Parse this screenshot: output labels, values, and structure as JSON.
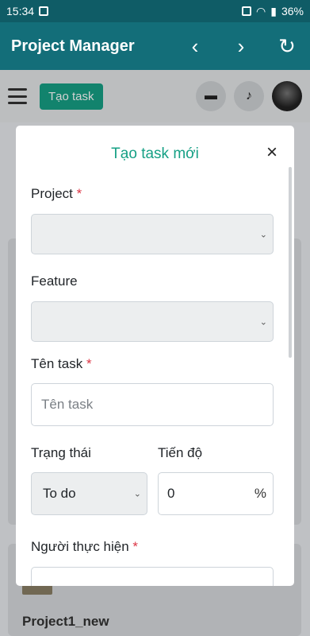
{
  "status": {
    "time": "15:34",
    "battery": "36%"
  },
  "appbar": {
    "title": "Project Manager"
  },
  "toolbar": {
    "create_button": "Tạo task"
  },
  "background": {
    "project_name": "Project1_new"
  },
  "modal": {
    "title": "Tạo task mới",
    "close": "×",
    "project_label": "Project",
    "required_mark": "*",
    "feature_label": "Feature",
    "task_name_label": "Tên task",
    "task_name_placeholder": "Tên task",
    "status_label": "Trạng thái",
    "status_value": "To do",
    "progress_label": "Tiến độ",
    "progress_value": "0",
    "progress_unit": "%",
    "assignee_label": "Người thực hiện"
  },
  "icons": {
    "back": "chevron-left-icon",
    "forward": "chevron-right-icon",
    "reload": "refresh-icon",
    "menu": "hamburger-icon",
    "chat": "chat-icon",
    "bell": "bell-icon"
  },
  "colors": {
    "appbar": "#136e79",
    "accent": "#16a085",
    "required": "#dc3545"
  }
}
